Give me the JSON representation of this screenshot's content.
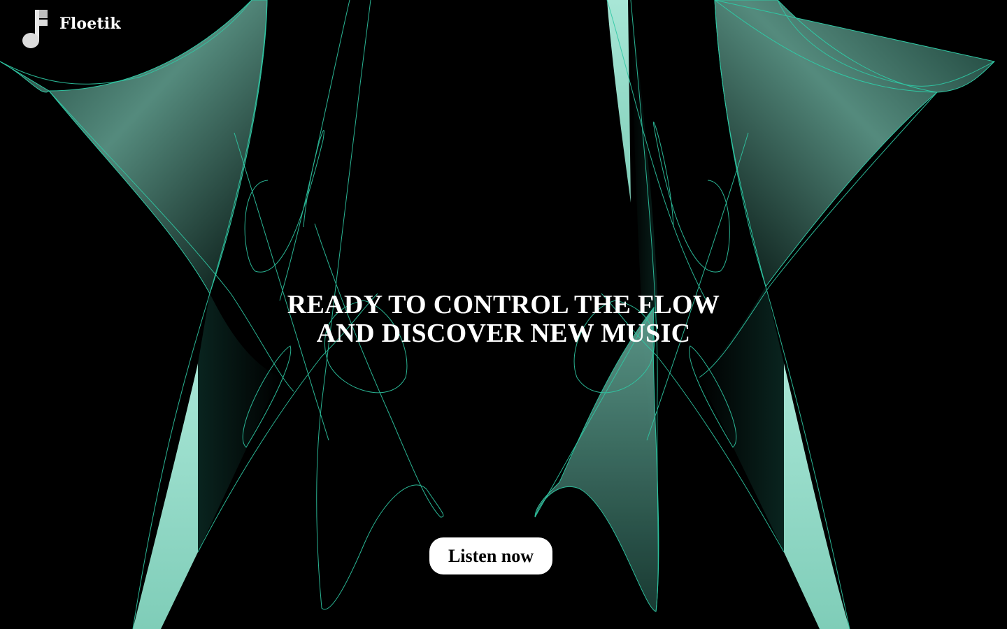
{
  "brand": {
    "name": "Floetik",
    "logo_icon": "music-note-icon"
  },
  "hero": {
    "line1": "READY TO CONTROL THE FLOW",
    "line2": "AND DISCOVER NEW MUSIC"
  },
  "cta": {
    "label": "Listen now"
  },
  "colors": {
    "background": "#000000",
    "accent_stroke": "#2fc8a4",
    "accent_fill_light": "#a8e6d6",
    "accent_fill_mid": "#4f8d7e",
    "text": "#ffffff",
    "button_bg": "#ffffff",
    "button_text": "#000000"
  }
}
